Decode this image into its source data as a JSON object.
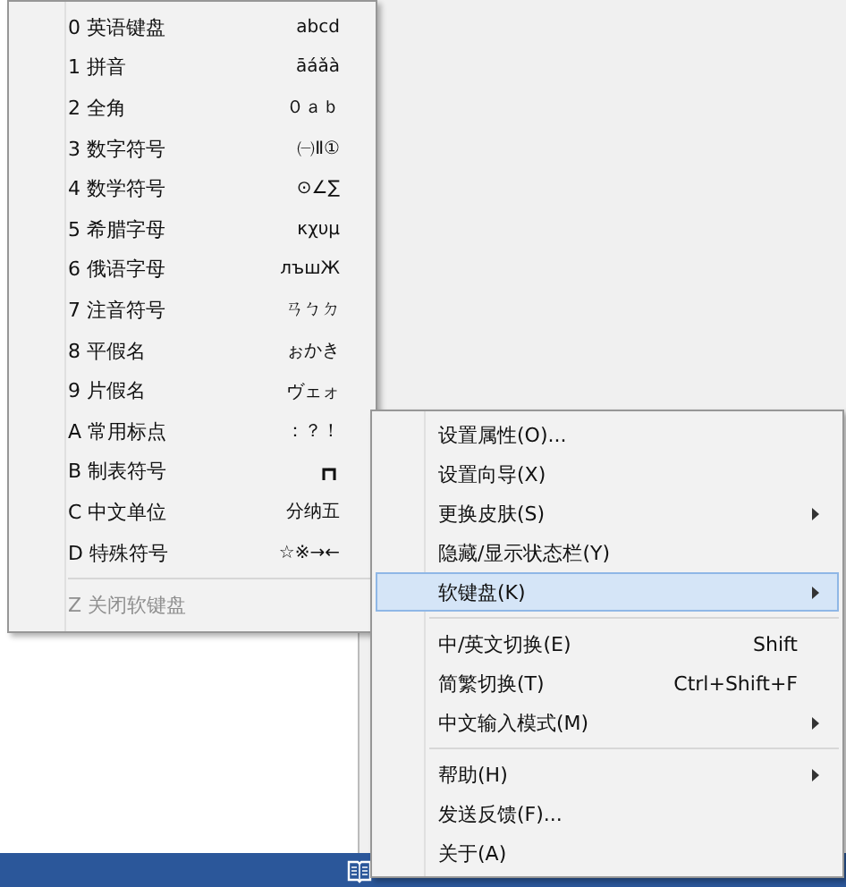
{
  "soft_keyboard_menu": {
    "items": [
      {
        "label": "0 英语键盘",
        "sample": "abcd"
      },
      {
        "label": "1 拼音",
        "sample": "āáǎà"
      },
      {
        "label": "2 全角",
        "sample": "０ａｂ"
      },
      {
        "label": "3 数字符号",
        "sample": "㈠Ⅱ①"
      },
      {
        "label": "4 数学符号",
        "sample": "⊙∠∑"
      },
      {
        "label": "5 希腊字母",
        "sample": "κχυμ"
      },
      {
        "label": "6 俄语字母",
        "sample": "лъшЖ"
      },
      {
        "label": "7 注音符号",
        "sample": "ㄢㄅㄉ"
      },
      {
        "label": "8 平假名",
        "sample": "ぉかき"
      },
      {
        "label": "9 片假名",
        "sample": "ヴェォ"
      },
      {
        "label": "A 常用标点",
        "sample": "：？！"
      },
      {
        "label": "B 制表符号",
        "sample": "┏┓"
      },
      {
        "label": "C 中文单位",
        "sample": "分纳五"
      },
      {
        "label": "D 特殊符号",
        "sample": "☆※→←"
      }
    ],
    "close_item": {
      "label": "Z 关闭软键盘",
      "disabled": true
    }
  },
  "context_menu": {
    "items": [
      {
        "kind": "item",
        "label": "设置属性(O)...",
        "has_submenu": false,
        "selected": false
      },
      {
        "kind": "item",
        "label": "设置向导(X)",
        "has_submenu": false,
        "selected": false
      },
      {
        "kind": "item",
        "label": "更换皮肤(S)",
        "has_submenu": true,
        "selected": false
      },
      {
        "kind": "item",
        "label": "隐藏/显示状态栏(Y)",
        "has_submenu": false,
        "selected": false
      },
      {
        "kind": "item",
        "label": "软键盘(K)",
        "has_submenu": true,
        "selected": true
      },
      {
        "kind": "separator"
      },
      {
        "kind": "item",
        "label": "中/英文切换(E)",
        "shortcut": "Shift",
        "has_submenu": false,
        "selected": false
      },
      {
        "kind": "item",
        "label": "简繁切换(T)",
        "shortcut": "Ctrl+Shift+F",
        "has_submenu": false,
        "selected": false
      },
      {
        "kind": "item",
        "label": "中文输入模式(M)",
        "has_submenu": true,
        "selected": false
      },
      {
        "kind": "separator"
      },
      {
        "kind": "item",
        "label": "帮助(H)",
        "has_submenu": true,
        "selected": false
      },
      {
        "kind": "item",
        "label": "发送反馈(F)...",
        "has_submenu": false,
        "selected": false
      },
      {
        "kind": "item",
        "label": "关于(A)",
        "has_submenu": false,
        "selected": false
      }
    ]
  }
}
